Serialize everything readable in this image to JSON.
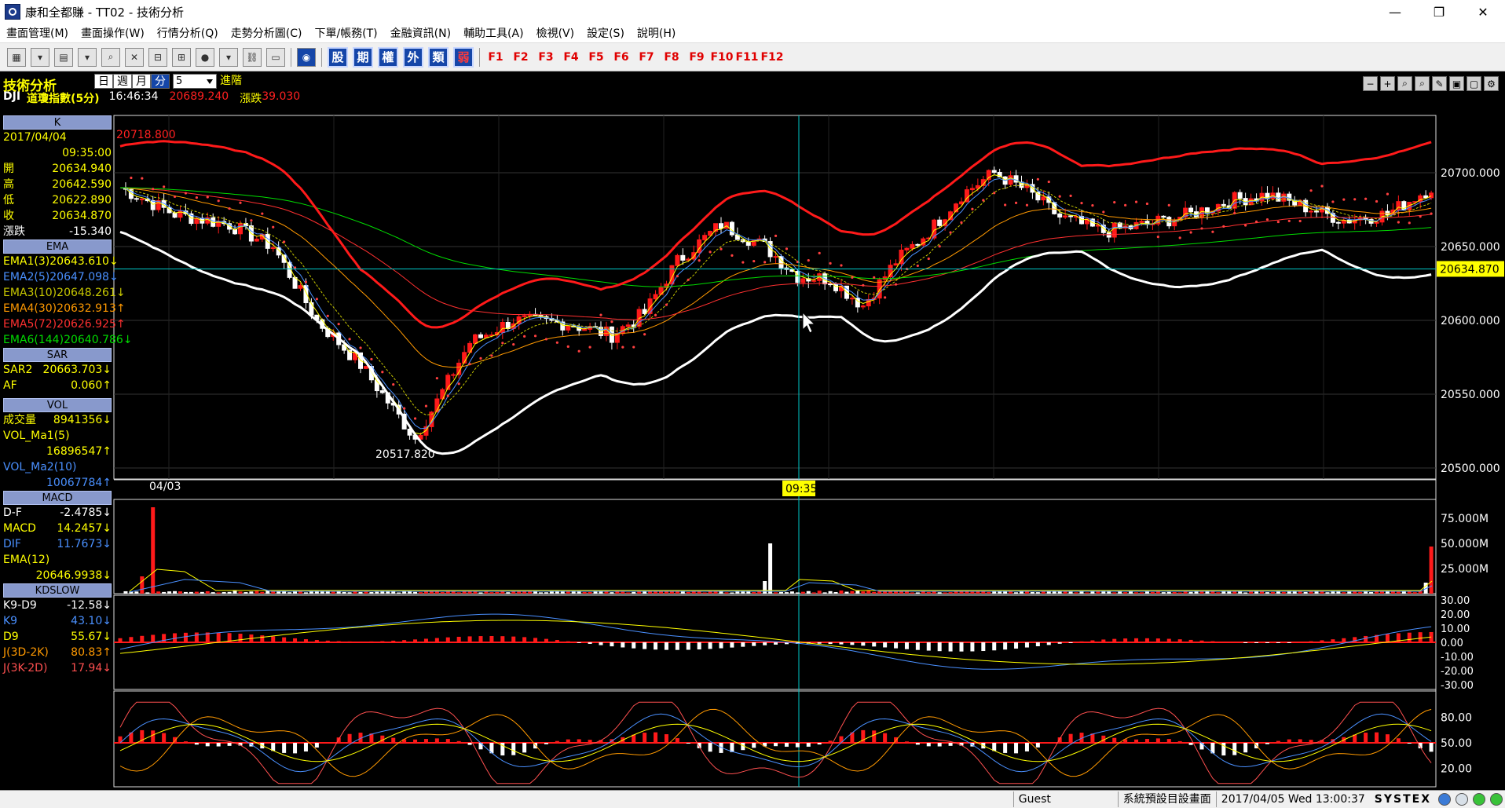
{
  "window": {
    "title": "康和全都賺 - TT02 - 技術分析",
    "controls": [
      "—",
      "❐",
      "✕"
    ]
  },
  "menu": [
    "畫面管理(M)",
    "畫面操作(W)",
    "行情分析(Q)",
    "走勢分析圖(C)",
    "下單/帳務(T)",
    "金融資訊(N)",
    "輔助工具(A)",
    "檢視(V)",
    "設定(S)",
    "說明(H)"
  ],
  "toolbar": {
    "category_buttons": [
      "股",
      "期",
      "權",
      "外",
      "類",
      "弱"
    ],
    "fkeys": [
      "F1",
      "F2",
      "F3",
      "F4",
      "F5",
      "F6",
      "F7",
      "F8",
      "F9",
      "F10",
      "F11",
      "F12"
    ]
  },
  "header": {
    "title": "技術分析",
    "periods": [
      "日",
      "週",
      "月",
      "分"
    ],
    "active_period": "分",
    "interval": "5",
    "advanced": "進階",
    "symbol": "DJI",
    "name": "道瓊指數(5分)",
    "time": "16:46:34",
    "price": "20689.240",
    "change_label": "漲跌",
    "change": "39.030"
  },
  "panels": {
    "k": {
      "title": "K",
      "date": "2017/04/04",
      "time": "09:35:00",
      "rows": [
        {
          "label": "開",
          "value": "20634.940",
          "color": "#ffff00"
        },
        {
          "label": "高",
          "value": "20642.590",
          "color": "#ffff00"
        },
        {
          "label": "低",
          "value": "20622.890",
          "color": "#ffff00"
        },
        {
          "label": "收",
          "value": "20634.870",
          "color": "#ffff00"
        },
        {
          "label": "漲跌",
          "value": "-15.340",
          "color": "#ffffff"
        }
      ]
    },
    "ema": {
      "title": "EMA",
      "items": [
        {
          "label": "EMA1(3)",
          "value": "20643.610",
          "arrow": "↓",
          "color": "#ffff00"
        },
        {
          "label": "EMA2(5)",
          "value": "20647.098",
          "arrow": "↓",
          "color": "#4a90ff"
        },
        {
          "label": "EMA3(10)",
          "value": "20648.261",
          "arrow": "↓",
          "color": "#c8c800"
        },
        {
          "label": "EMA4(30)",
          "value": "20632.913",
          "arrow": "↑",
          "color": "#ff9900"
        },
        {
          "label": "EMA5(72)",
          "value": "20626.925",
          "arrow": "↑",
          "color": "#ff3030"
        },
        {
          "label": "EMA6(144)",
          "value": "20640.786",
          "arrow": "↓",
          "color": "#00dd00"
        }
      ]
    },
    "sar": {
      "title": "SAR",
      "rows": [
        {
          "label": "SAR2",
          "value": "20663.703",
          "arrow": "↓",
          "color": "#ffff00"
        },
        {
          "label": "AF",
          "value": "0.060",
          "arrow": "↑",
          "color": "#ffff00"
        }
      ]
    },
    "vol": {
      "title": "VOL",
      "rows": [
        {
          "label": "成交量",
          "value": "8941356",
          "arrow": "↓",
          "color": "#ffff00"
        },
        {
          "label": "VOL_Ma1(5)",
          "value": "",
          "arrow": "",
          "color": "#ffff00"
        },
        {
          "label": "",
          "value": "16896547",
          "arrow": "↑",
          "color": "#ffff00"
        },
        {
          "label": "VOL_Ma2(10)",
          "value": "",
          "arrow": "",
          "color": "#4a90ff"
        },
        {
          "label": "",
          "value": "10067784",
          "arrow": "↑",
          "color": "#4a90ff"
        }
      ]
    },
    "macd": {
      "title": "MACD",
      "rows": [
        {
          "label": "D-F",
          "value": "-2.4785",
          "arrow": "↓",
          "color": "#ffffff"
        },
        {
          "label": "MACD",
          "value": "14.2457",
          "arrow": "↓",
          "color": "#ffff00"
        },
        {
          "label": "DIF",
          "value": "11.7673",
          "arrow": "↓",
          "color": "#4a90ff"
        },
        {
          "label": "EMA(12)",
          "value": "",
          "arrow": "",
          "color": "#ffff00"
        },
        {
          "label": "",
          "value": "20646.9938",
          "arrow": "↓",
          "color": "#ffff00"
        }
      ]
    },
    "kd": {
      "title": "KDSLOW",
      "rows": [
        {
          "label": "K9-D9",
          "value": "-12.58",
          "arrow": "↓",
          "color": "#ffffff"
        },
        {
          "label": "K9",
          "value": "43.10",
          "arrow": "↓",
          "color": "#4a90ff"
        },
        {
          "label": "D9",
          "value": "55.67",
          "arrow": "↓",
          "color": "#ffff00"
        },
        {
          "label": "J(3D-2K)",
          "value": "80.83",
          "arrow": "↑",
          "color": "#ff9900"
        },
        {
          "label": "J(3K-2D)",
          "value": "17.94",
          "arrow": "↓",
          "color": "#ff5050"
        }
      ]
    }
  },
  "chart_data": {
    "type": "line",
    "price_axis": {
      "ticks": [
        "20700.000",
        "20650.000",
        "20600.000",
        "20550.000",
        "20500.000"
      ],
      "current": "20634.870"
    },
    "annotations": {
      "high": "20718.800",
      "low": "20517.820",
      "date": "04/03",
      "cursor_time": "09:35"
    },
    "volume_axis": {
      "ticks": [
        "75.000M",
        "50.000M",
        "25.000M"
      ]
    },
    "macd_axis": {
      "ticks": [
        "30.00",
        "20.00",
        "10.00",
        "0.00",
        "-10.00",
        "-20.00",
        "-30.00"
      ]
    },
    "kd_axis": {
      "ticks": [
        "80.00",
        "50.00",
        "20.00"
      ]
    },
    "colors": {
      "up": "#ff1a1a",
      "down": "#ffffff",
      "bb_upper": "#ff1a1a",
      "bb_lower": "#ffffff",
      "sar": "#ff4040"
    }
  },
  "statusbar": {
    "user": "Guest",
    "layout": "系統預設目設畫面",
    "datetime": "2017/04/05 Wed 13:00:37",
    "brand": "SYSTEX"
  }
}
